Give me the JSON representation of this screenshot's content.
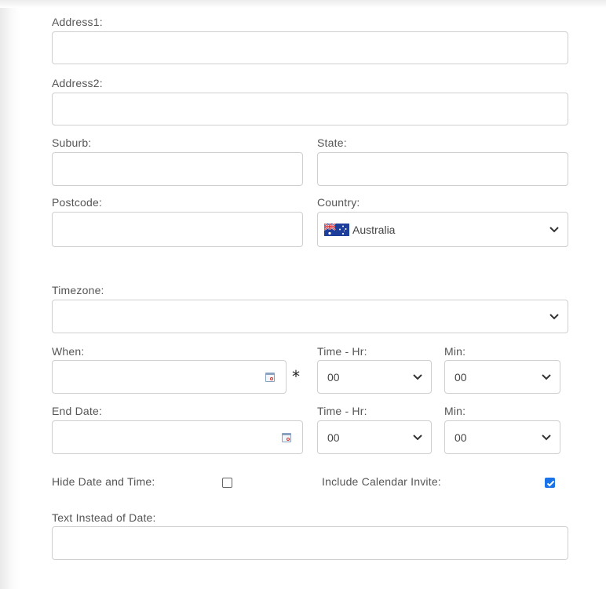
{
  "labels": {
    "address1": "Address1:",
    "address2": "Address2:",
    "suburb": "Suburb:",
    "state": "State:",
    "postcode": "Postcode:",
    "country": "Country:",
    "timezone": "Timezone:",
    "when": "When:",
    "time_hr": "Time - Hr:",
    "min": "Min:",
    "end_date": "End Date:",
    "hide_date_time": "Hide Date and Time:",
    "include_calendar_invite": "Include Calendar Invite:",
    "text_instead_of_date": "Text Instead of Date:"
  },
  "fields": {
    "address1": "",
    "address2": "",
    "suburb": "",
    "state": "",
    "postcode": "",
    "country": "Australia",
    "country_flag": "australia-flag-icon",
    "timezone": "",
    "when": "",
    "when_hour": "00",
    "when_min": "00",
    "end_date": "",
    "end_hour": "00",
    "end_min": "00",
    "hide_date_time": false,
    "include_calendar_invite": true,
    "text_instead_of_date": ""
  },
  "required_marker": "*",
  "colors": {
    "accent": "#1a73e8",
    "border": "#cfcfcf",
    "label": "#555555"
  }
}
